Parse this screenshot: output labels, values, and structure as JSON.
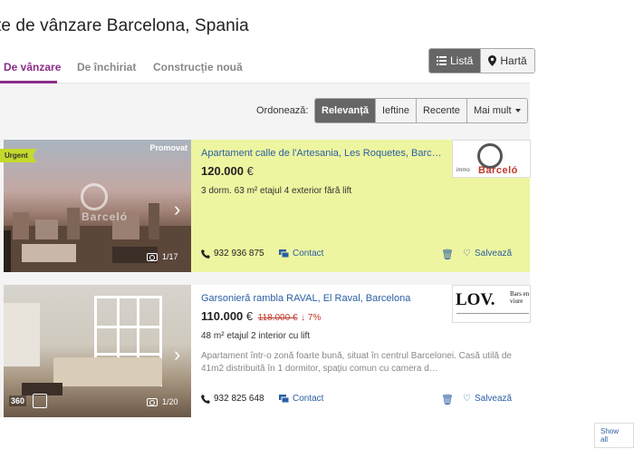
{
  "header": {
    "title": "te de vânzare Barcelona, Spania"
  },
  "tabs": [
    {
      "label": "De vânzare",
      "active": true
    },
    {
      "label": "De închiriat",
      "active": false
    },
    {
      "label": "Construcție nouă",
      "active": false
    }
  ],
  "view_toggle": {
    "list_label": "Listă",
    "map_label": "Hartă",
    "list_icon": "list-icon",
    "map_icon": "map-pin-icon"
  },
  "sort": {
    "label": "Ordonează:",
    "options": [
      "Relevanță",
      "Ieftine",
      "Recente",
      "Mai mult"
    ],
    "active": "Relevanță"
  },
  "listings": [
    {
      "badge": "Urgent",
      "promo": "Promovat",
      "watermark": "Barceló",
      "photo_count": "1/17",
      "title": "Apartament calle de l'Artesania, Les Roquetes, Barc…",
      "price": "120.000",
      "currency": "€",
      "details": "3 dorm.   63 m²   etajul 4 exterior fără lift",
      "phone": "932 936 875",
      "contact_label": "Contact",
      "save_label": "Salvează",
      "agency_logo_text": "Barceló",
      "agency_logo_prefix": "immo",
      "highlight_color": "#eef5a0"
    },
    {
      "b360": "360",
      "photo_count": "1/20",
      "title": "Garsonieră rambla RAVAL, El Raval, Barcelona",
      "price": "110.000",
      "currency": "€",
      "old_price": "118.000 €",
      "price_drop": "↓ 7%",
      "details": "48 m²   etajul 2 interior cu lift",
      "description": "Apartament într-o zonă foarte bună, situat în centrul Barcelonei. Casă utilă de 41m2 distribuită în 1 dormitor, spațiu comun cu camera d…",
      "phone": "932 825 648",
      "contact_label": "Contact",
      "save_label": "Salvează",
      "agency_logo_text": "LOV.",
      "agency_logo_side": "Bars en viure"
    }
  ],
  "footer": {
    "show_all": "Show all"
  },
  "colors": {
    "brand": "#8a2d88",
    "link": "#2b5fa3",
    "urgent": "#c5d92c",
    "price_drop": "#c0392b"
  }
}
